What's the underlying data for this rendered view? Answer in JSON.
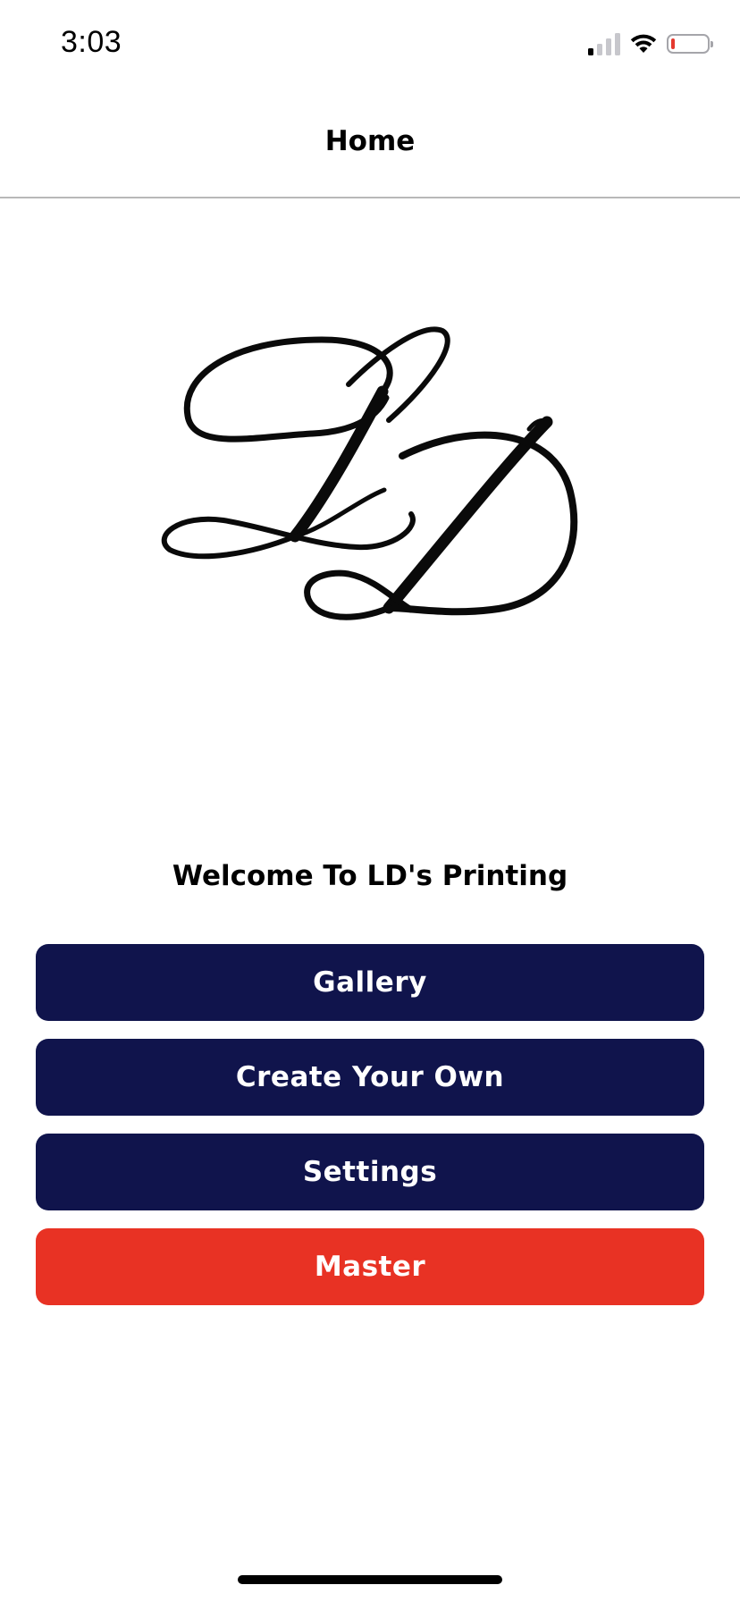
{
  "status_bar": {
    "time": "3:03",
    "signal_icon": "cellular-signal-icon",
    "signal_bars_active": 1,
    "signal_bars_total": 4,
    "wifi_icon": "wifi-icon",
    "battery_icon": "battery-icon",
    "battery_level": 0.1,
    "battery_color": "#e5392f"
  },
  "nav": {
    "title": "Home"
  },
  "logo": {
    "icon": "ld-monogram-logo",
    "text": "LD"
  },
  "welcome": {
    "text": "Welcome To LD's Printing"
  },
  "buttons": [
    {
      "label": "Gallery",
      "color": "#10144c"
    },
    {
      "label": "Create Your Own",
      "color": "#10144c"
    },
    {
      "label": "Settings",
      "color": "#10144c"
    },
    {
      "label": "Master",
      "color": "#e83224"
    }
  ]
}
